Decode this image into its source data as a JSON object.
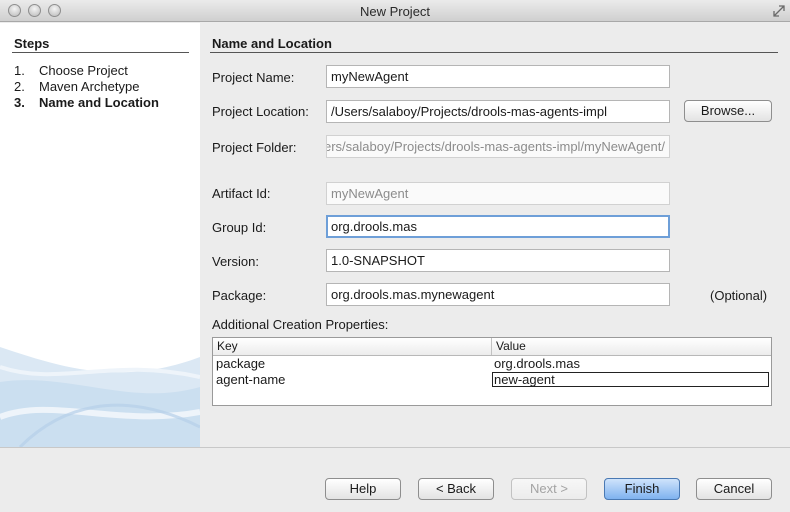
{
  "window": {
    "title": "New Project"
  },
  "steps": {
    "title": "Steps",
    "items": [
      {
        "num": "1.",
        "label": "Choose Project"
      },
      {
        "num": "2.",
        "label": "Maven Archetype"
      },
      {
        "num": "3.",
        "label": "Name and Location"
      }
    ]
  },
  "section": {
    "title": "Name and Location"
  },
  "form": {
    "project_name": {
      "label": "Project Name:",
      "value": "myNewAgent"
    },
    "project_location": {
      "label": "Project Location:",
      "value": "/Users/salaboy/Projects/drools-mas-agents-impl"
    },
    "browse_label": "Browse...",
    "project_folder": {
      "label": "Project Folder:",
      "value": "/Users/salaboy/Projects/drools-mas-agents-impl/myNewAgent"
    },
    "artifact_id": {
      "label": "Artifact Id:",
      "value": "myNewAgent"
    },
    "group_id": {
      "label": "Group Id:",
      "value": "org.drools.mas"
    },
    "version": {
      "label": "Version:",
      "value": "1.0-SNAPSHOT"
    },
    "package": {
      "label": "Package:",
      "value": "org.drools.mas.mynewagent",
      "hint": "(Optional)"
    }
  },
  "properties": {
    "label": "Additional Creation Properties:",
    "columns": [
      "Key",
      "Value"
    ],
    "rows": [
      {
        "key": "package",
        "value": "org.drools.mas"
      },
      {
        "key": "agent-name",
        "value": "new-agent"
      }
    ]
  },
  "buttons": {
    "help": "Help",
    "back": "< Back",
    "next": "Next >",
    "finish": "Finish",
    "cancel": "Cancel"
  },
  "colors": {
    "accent": "#6e9fd8",
    "default_button": "#7fb2ef"
  }
}
